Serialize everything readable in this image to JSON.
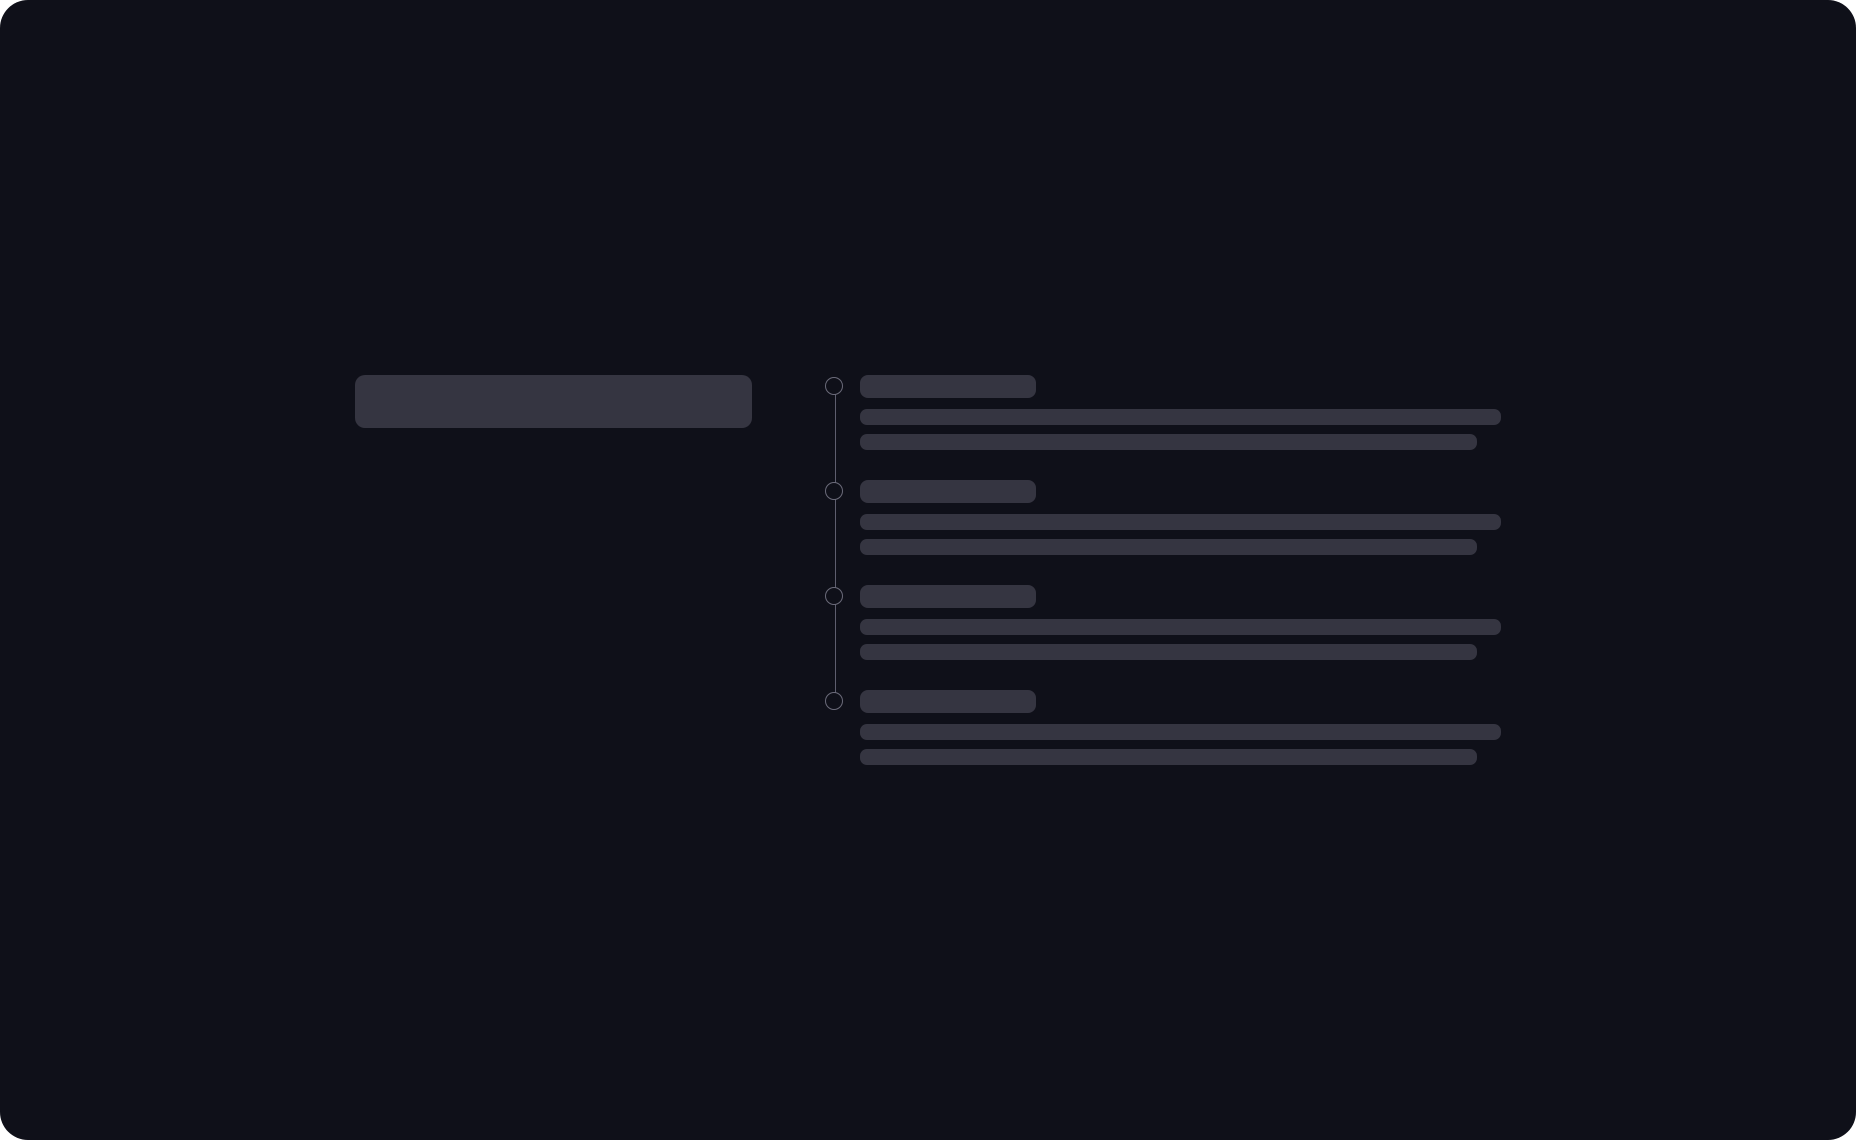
{
  "screen": {
    "state": "loading",
    "background": "#0f1019",
    "skeleton_color": "#353541",
    "connector_color": "#5e5e6e"
  },
  "content": {
    "title": "",
    "timeline_steps": [
      {
        "title": "",
        "description_lines": [
          "",
          ""
        ]
      },
      {
        "title": "",
        "description_lines": [
          "",
          ""
        ]
      },
      {
        "title": "",
        "description_lines": [
          "",
          ""
        ]
      },
      {
        "title": "",
        "description_lines": [
          "",
          ""
        ]
      }
    ]
  }
}
